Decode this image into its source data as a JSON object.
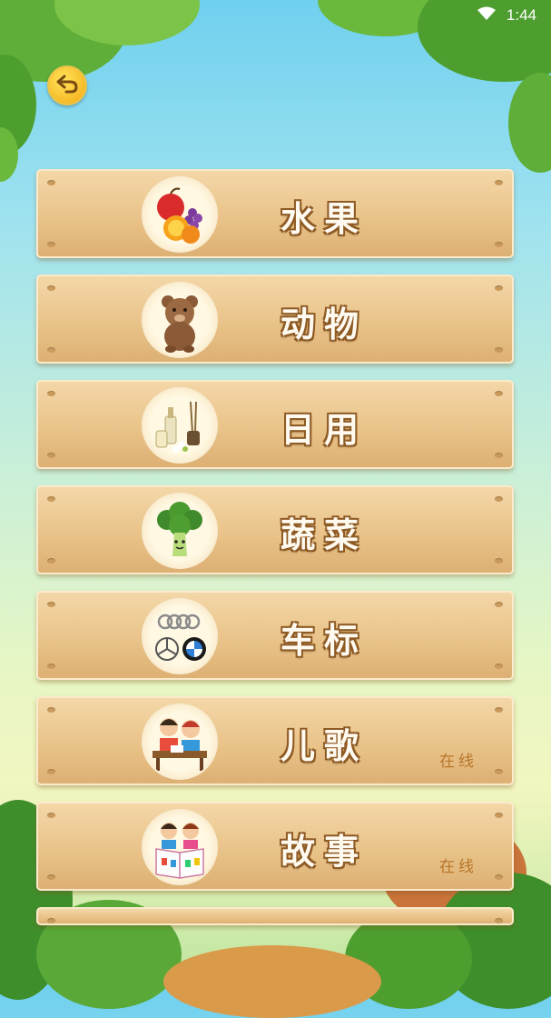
{
  "status_bar": {
    "time": "1:44"
  },
  "categories": [
    {
      "label": "水果",
      "icon": "fruit-icon",
      "online": ""
    },
    {
      "label": "动物",
      "icon": "bear-icon",
      "online": ""
    },
    {
      "label": "日用",
      "icon": "daily-items-icon",
      "online": ""
    },
    {
      "label": "蔬菜",
      "icon": "broccoli-icon",
      "online": ""
    },
    {
      "label": "车标",
      "icon": "car-logo-icon",
      "online": ""
    },
    {
      "label": "儿歌",
      "icon": "children-song-icon",
      "online": "在线"
    },
    {
      "label": "故事",
      "icon": "story-icon",
      "online": "在线"
    }
  ],
  "colors": {
    "plank": "#e9c389",
    "label_outline": "#8e5a24",
    "online_text": "#b8762a"
  }
}
